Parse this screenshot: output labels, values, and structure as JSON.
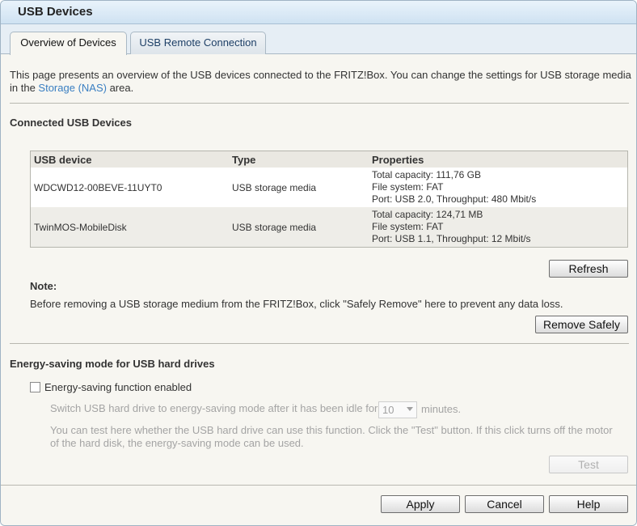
{
  "window": {
    "title": "USB Devices"
  },
  "tabs": [
    {
      "label": "Overview of Devices",
      "active": true
    },
    {
      "label": "USB Remote Connection",
      "active": false
    }
  ],
  "intro": {
    "text_before": "This page presents an overview of the USB devices connected to the FRITZ!Box. You can change the settings for USB storage media in the ",
    "link": "Storage (NAS)",
    "text_after": " area."
  },
  "connected": {
    "title": "Connected USB Devices",
    "columns": [
      "USB device",
      "Type",
      "Properties"
    ],
    "devices": [
      {
        "name": "WDCWD12-00BEVE-11UYT0",
        "type": "USB storage media",
        "properties": [
          "Total capacity: 111,76 GB",
          "File system: FAT",
          "Port: USB 2.0, Throughput: 480 Mbit/s"
        ]
      },
      {
        "name": "TwinMOS-MobileDisk",
        "type": "USB storage media",
        "properties": [
          "Total capacity: 124,71 MB",
          "File system: FAT",
          "Port: USB 1.1, Throughput: 12 Mbit/s"
        ]
      }
    ],
    "refresh_label": "Refresh"
  },
  "note": {
    "title": "Note:",
    "text": "Before removing a USB storage medium from the FRITZ!Box, click \"Safely Remove\" here to prevent any data loss.",
    "remove_label": "Remove Safely"
  },
  "energy": {
    "title": "Energy-saving mode for USB hard drives",
    "checkbox_label": "Energy-saving function enabled",
    "checked": false,
    "idle_text": "Switch USB hard drive to energy-saving mode after it has been idle for",
    "idle_value": "10",
    "minutes_label": "minutes.",
    "test_desc": "You can test here whether the USB hard drive can use this function. Click the \"Test\" button. If this click turns off the motor of the hard disk, the energy-saving mode can be used.",
    "test_label": "Test"
  },
  "footer": {
    "apply_label": "Apply",
    "cancel_label": "Cancel",
    "help_label": "Help"
  }
}
